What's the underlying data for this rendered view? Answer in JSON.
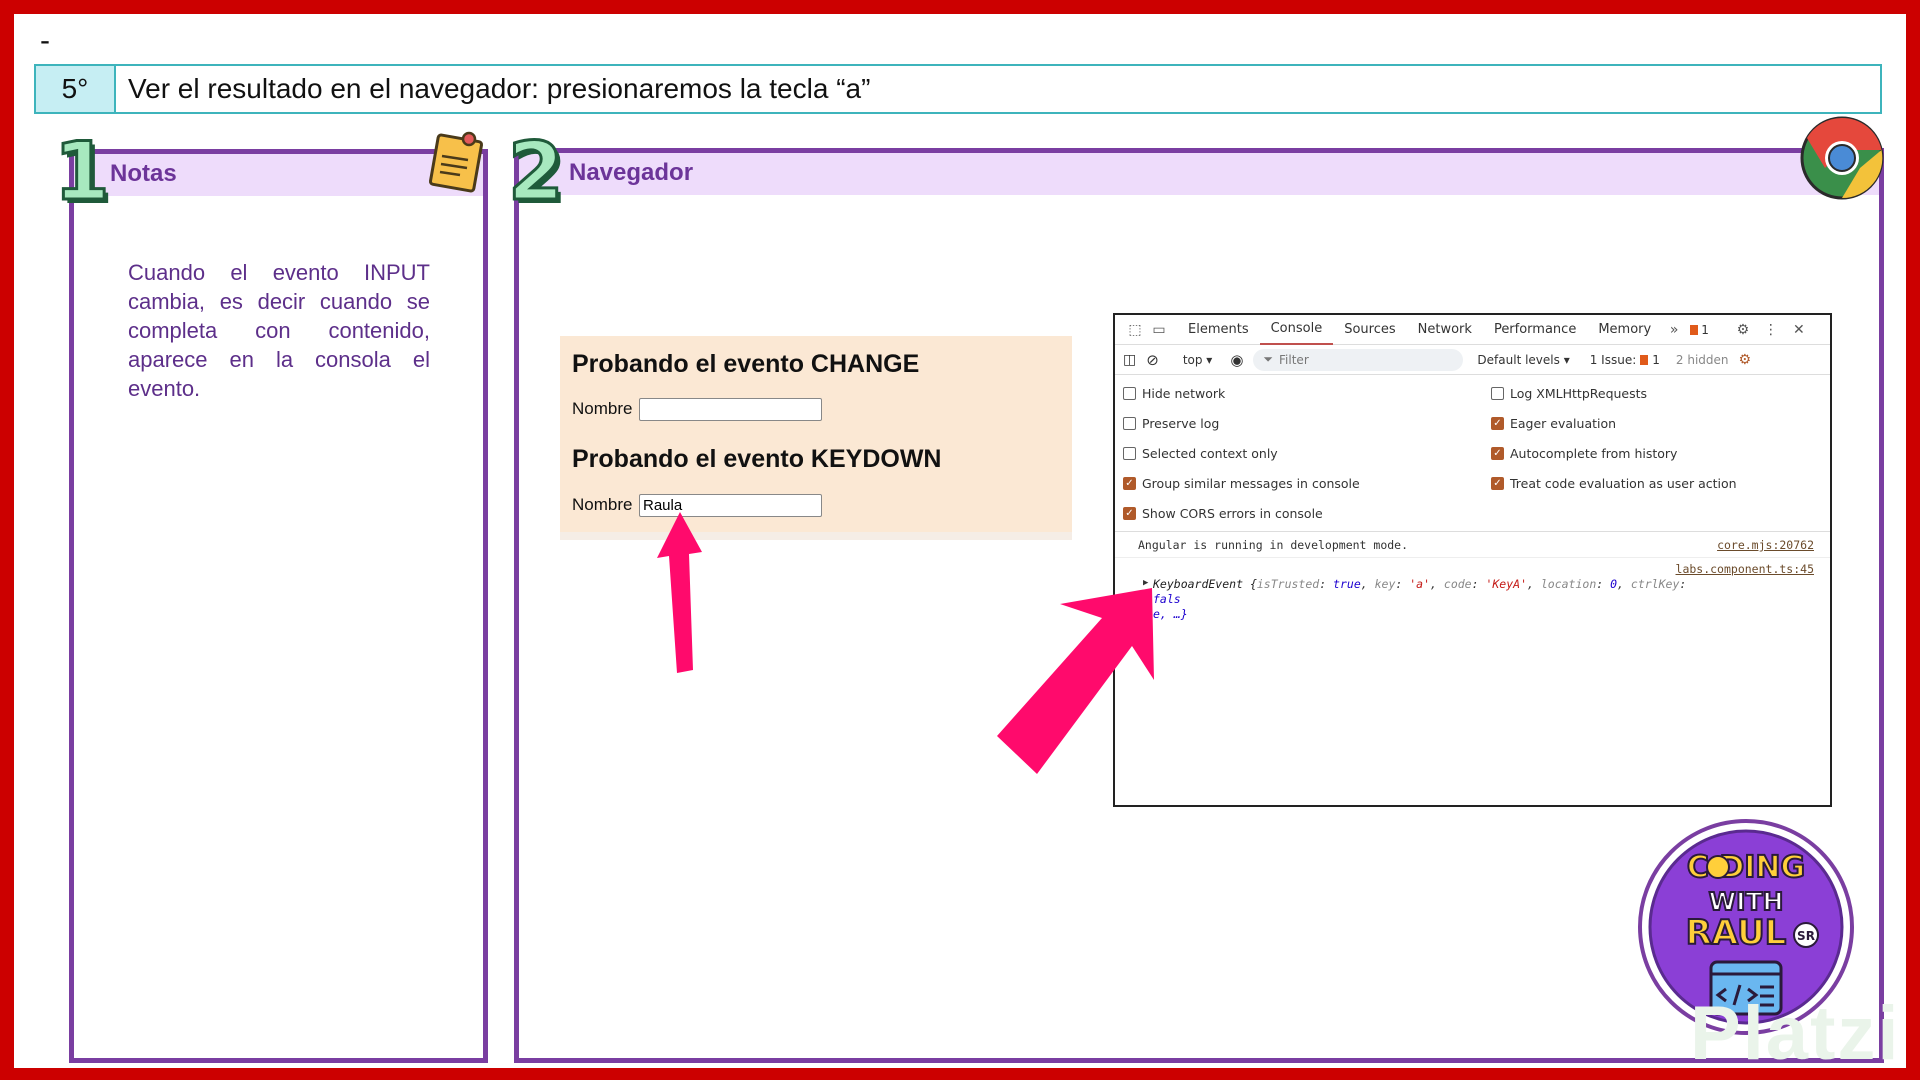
{
  "header": {
    "dash": "-"
  },
  "step": {
    "number": "5°",
    "text": "Ver el resultado en el navegador: presionaremos la tecla “a”"
  },
  "notes_panel": {
    "number": "1",
    "title": "Notas",
    "body": "Cuando el evento INPUT cambia, es decir cuando se completa con contenido, aparece en la consola el evento."
  },
  "browser_panel": {
    "number": "2",
    "title": "Navegador"
  },
  "webpage": {
    "heading_change": "Probando el evento CHANGE",
    "label_change": "Nombre",
    "input_change_value": "",
    "heading_keydown": "Probando el evento KEYDOWN",
    "label_keydown": "Nombre",
    "input_keydown_value": "Raula"
  },
  "devtools": {
    "tabs": [
      "Elements",
      "Console",
      "Sources",
      "Network",
      "Performance",
      "Memory"
    ],
    "active_tab": "Console",
    "more_tabs": "»",
    "issues_badge": "1",
    "toolbar": {
      "context": "top",
      "filter_placeholder": "Filter",
      "levels": "Default levels",
      "issues": "1 Issue:",
      "issues_count": "1",
      "hidden": "2 hidden"
    },
    "settings_left": [
      {
        "label": "Hide network",
        "checked": false
      },
      {
        "label": "Preserve log",
        "checked": false
      },
      {
        "label": "Selected context only",
        "checked": false
      },
      {
        "label": "Group similar messages in console",
        "checked": true
      },
      {
        "label": "Show CORS errors in console",
        "checked": true
      }
    ],
    "settings_right": [
      {
        "label": "Log XMLHttpRequests",
        "checked": false
      },
      {
        "label": "Eager evaluation",
        "checked": true
      },
      {
        "label": "Autocomplete from history",
        "checked": true
      },
      {
        "label": "Treat code evaluation as user action",
        "checked": true
      }
    ],
    "log": [
      {
        "message": "Angular is running in development mode.",
        "source": "core.mjs:20762"
      },
      {
        "source": "labs.component.ts:45"
      }
    ],
    "keyboard_event": {
      "type": "KeyboardEvent",
      "open": " {",
      "k1": "isTrusted",
      "v1": "true",
      "k2": "key",
      "v2": "'a'",
      "k3": "code",
      "v3": "'KeyA'",
      "k4": "location",
      "v4": "0",
      "k5": "ctrlKey",
      "v5": "fals",
      "tail": "e, …}"
    }
  },
  "colors": {
    "frame": "#cc0000",
    "panel_border": "#7a3ea1",
    "panel_header": "#eedcfb",
    "step_border": "#3db4bc",
    "arrow": "#ff0a6c"
  },
  "logos": {
    "coding_line1": "C   DING",
    "coding_line2": "WITH",
    "coding_line3": "RAUL",
    "coding_badge": "SR",
    "watermark": "Platzi"
  }
}
